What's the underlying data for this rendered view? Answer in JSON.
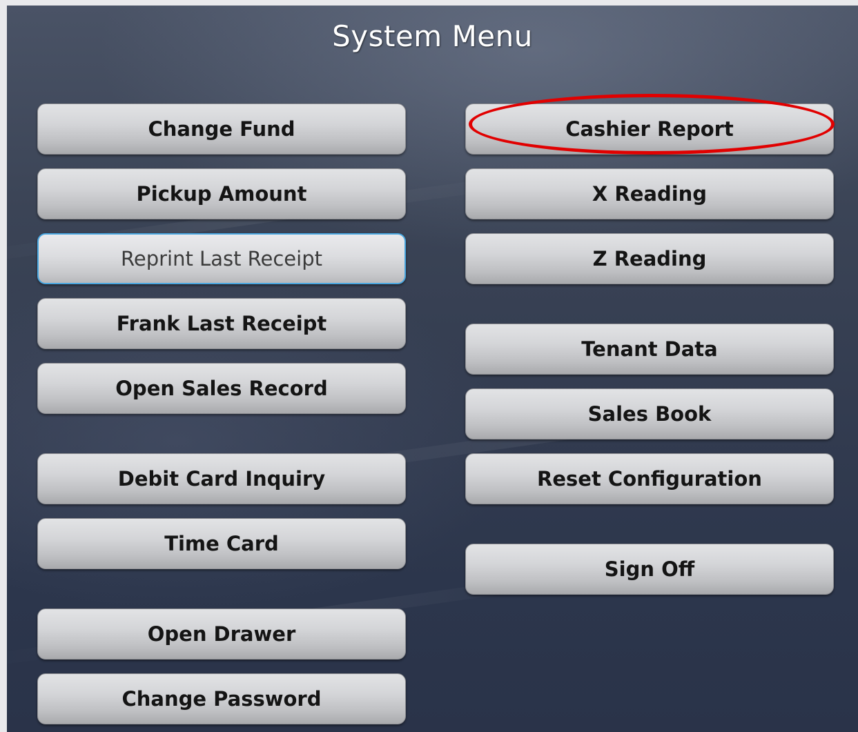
{
  "title": "System Menu",
  "left_menu": [
    {
      "label": "Change Fund"
    },
    {
      "label": "Pickup Amount"
    },
    {
      "label": "Reprint Last Receipt",
      "focused": true
    },
    {
      "label": "Frank Last Receipt"
    },
    {
      "label": "Open Sales Record"
    },
    {
      "label": "Debit Card Inquiry"
    },
    {
      "label": "Time Card"
    },
    {
      "label": "Open Drawer"
    },
    {
      "label": "Change Password"
    }
  ],
  "right_menu": [
    {
      "label": "Cashier Report",
      "annotated": true
    },
    {
      "label": "X Reading"
    },
    {
      "label": "Z Reading"
    },
    {
      "label": "Tenant Data"
    },
    {
      "label": "Sales Book"
    },
    {
      "label": "Reset Configuration"
    },
    {
      "label": "Sign Off"
    }
  ],
  "colors": {
    "annotation": "#e10000",
    "focus_border": "#4aa7e0",
    "background": "#333c50",
    "button_face": "#d4d5d8"
  }
}
